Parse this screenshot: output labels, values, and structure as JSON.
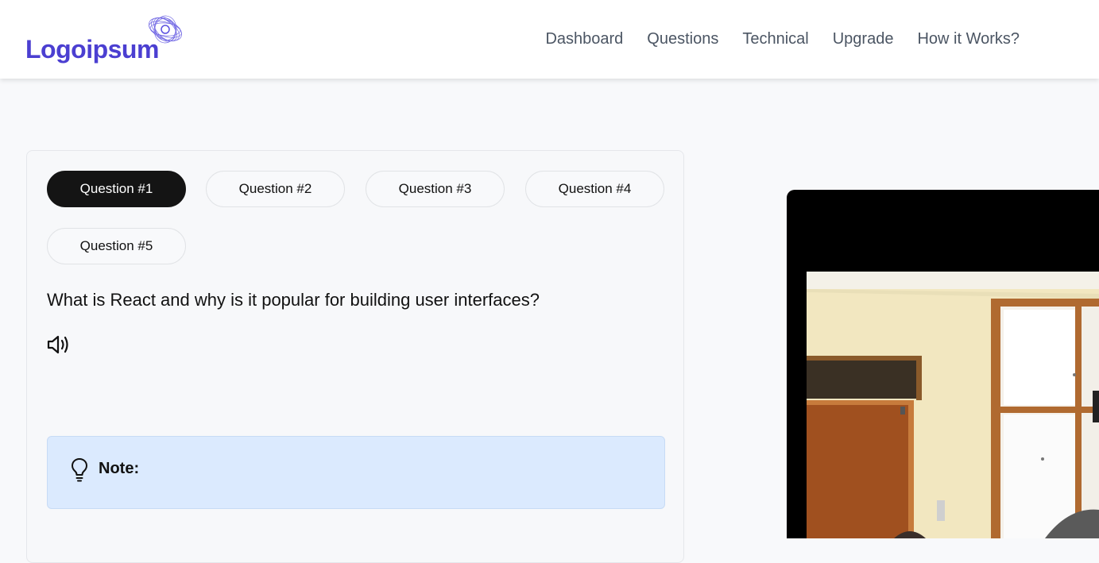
{
  "header": {
    "logo_text": "Logoipsum",
    "nav": [
      {
        "label": "Dashboard"
      },
      {
        "label": "Questions"
      },
      {
        "label": "Technical"
      },
      {
        "label": "Upgrade"
      },
      {
        "label": "How it Works?"
      }
    ]
  },
  "question_panel": {
    "tabs": [
      {
        "label": "Question #1",
        "active": true
      },
      {
        "label": "Question #2",
        "active": false
      },
      {
        "label": "Question #3",
        "active": false
      },
      {
        "label": "Question #4",
        "active": false
      },
      {
        "label": "Question #5",
        "active": false
      }
    ],
    "question_text": "What is React and why is it popular for building user interfaces?",
    "speaker_icon": "volume-icon",
    "note": {
      "icon": "lightbulb-icon",
      "label": "Note:"
    }
  },
  "colors": {
    "brand": "#4b3fd1",
    "active_tab": "#141414",
    "note_bg": "#dbeafe",
    "page_bg": "#f8f9fb"
  }
}
